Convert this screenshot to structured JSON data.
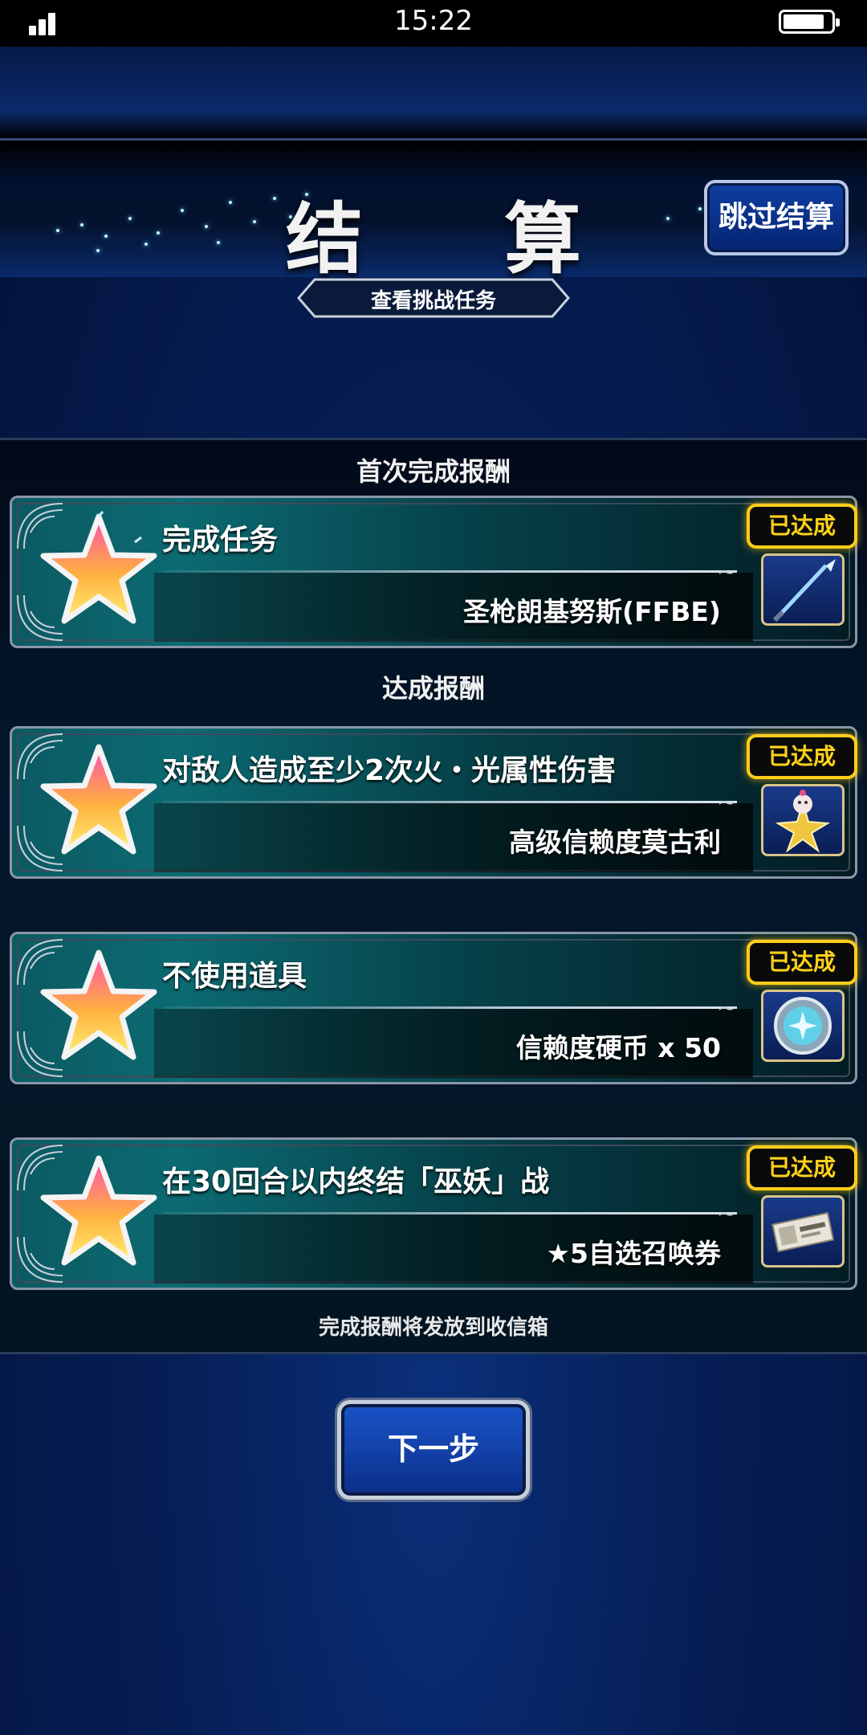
{
  "status_bar": {
    "time": "15:22",
    "signal_bars": 3,
    "battery_level": 0.8
  },
  "header": {
    "title": "结　算",
    "skip_label": "跳过结算",
    "view_missions_label": "查看挑战任务"
  },
  "sections": {
    "first_clear_label": "首次完成报酬",
    "achieve_label": "达成报酬"
  },
  "missions": [
    {
      "task": "完成任务",
      "reward": "圣枪朗基努斯(FFBE)",
      "status": "已达成",
      "icon": "spear-icon"
    },
    {
      "task": "对敌人造成至少2次火・光属性伤害",
      "reward": "高级信赖度莫古利",
      "status": "已达成",
      "icon": "moogle-star-icon"
    },
    {
      "task": "不使用道具",
      "reward": "信赖度硬币 x 50",
      "status": "已达成",
      "icon": "trust-coin-icon"
    },
    {
      "task": "在30回合以内终结「巫妖」战",
      "reward": "★5自选召唤券",
      "status": "已达成",
      "icon": "summon-ticket-icon"
    }
  ],
  "footnote": "完成报酬将发放到收信箱",
  "next_label": "下一步",
  "colors": {
    "badge_gold": "#ffcc1a",
    "card_teal": "#0c6a72",
    "button_blue": "#1a54c8"
  }
}
